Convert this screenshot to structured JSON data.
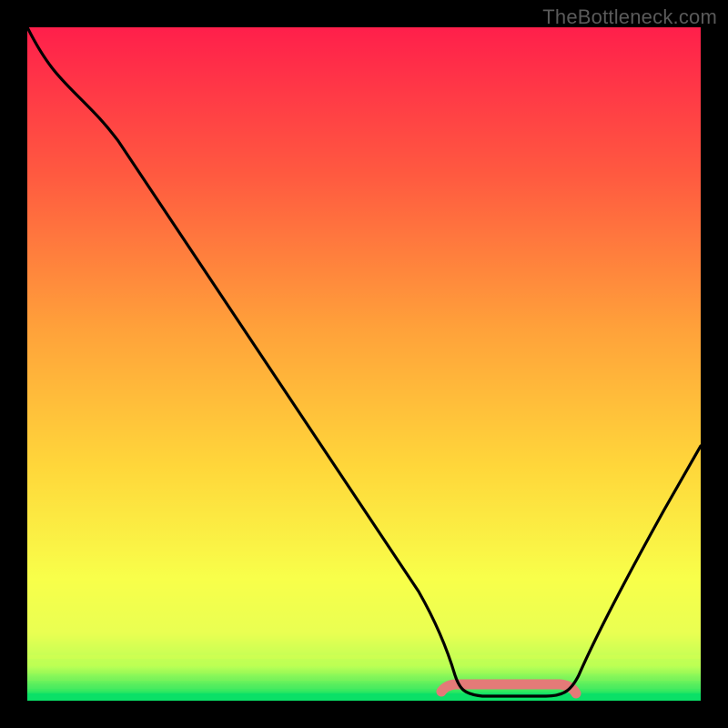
{
  "watermark": "TheBottleneck.com",
  "colors": {
    "gradient_top": "#ff1f4b",
    "gradient_mid1": "#ff6a3a",
    "gradient_mid2": "#ffd63a",
    "gradient_low": "#f6ff55",
    "gradient_bottom": "#00e064",
    "curve": "#000000",
    "pink_band": "#e47a78",
    "green_band": "#1fe06a"
  },
  "chart_data": {
    "type": "line",
    "title": "",
    "xlabel": "",
    "ylabel": "",
    "xlim": [
      0,
      100
    ],
    "ylim": [
      0,
      100
    ],
    "series": [
      {
        "name": "bottleneck-curve",
        "x": [
          0,
          4,
          10,
          20,
          30,
          40,
          50,
          58,
          62,
          66,
          70,
          74,
          78,
          82,
          86,
          90,
          94,
          100
        ],
        "y": [
          100,
          96,
          90,
          75,
          60,
          45,
          30,
          16,
          8,
          3,
          1,
          0,
          0,
          1,
          5,
          14,
          26,
          44
        ]
      }
    ],
    "optimal_band_x": [
      62,
      80
    ],
    "annotations": []
  }
}
